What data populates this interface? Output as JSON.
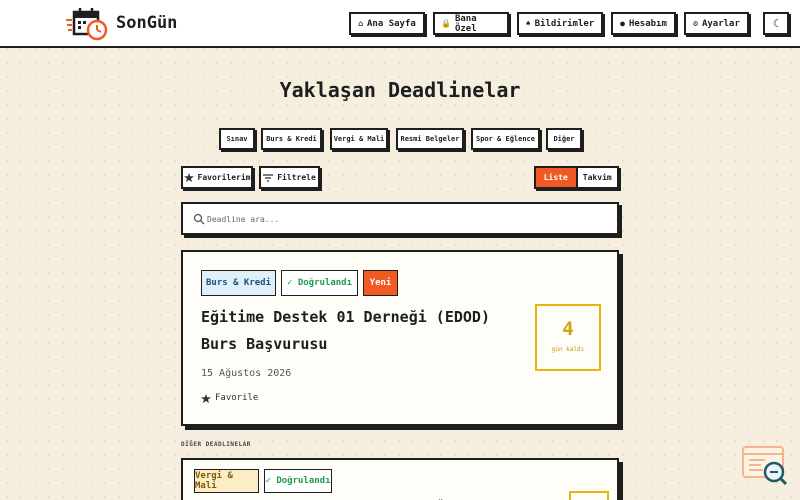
{
  "header": {
    "brand": "SonGün",
    "nav": [
      {
        "label": "Ana Sayfa",
        "icon": "home-icon",
        "glyph": "⌂"
      },
      {
        "label": "Bana Özel",
        "icon": "lock-icon",
        "glyph": "🔒"
      },
      {
        "label": "Bildirimler",
        "icon": "bell-icon",
        "glyph": "♠"
      },
      {
        "label": "Hesabım",
        "icon": "user-icon",
        "glyph": "●"
      },
      {
        "label": "Ayarlar",
        "icon": "gear-icon",
        "glyph": "⚙"
      }
    ],
    "theme_glyph": "☾"
  },
  "page_title": "Yaklaşan Deadlinelar",
  "categories": [
    "Sınav",
    "Burs & Kredi",
    "Vergi & Mali",
    "Resmi Belgeler",
    "Spor & Eğlence",
    "Diğer"
  ],
  "toolbar": {
    "favorites_label": "Favorilerim",
    "filter_label": "Filtrele",
    "view_list": "Liste",
    "view_calendar": "Takvim"
  },
  "search": {
    "placeholder": "Deadline ara..."
  },
  "featured": {
    "tags": [
      "Burs & Kredi",
      "✓ Doğrulandı",
      "Yeni"
    ],
    "title": "Eğitime Destek 01 Derneği (EDOD) Burs Başvurusu",
    "date": "15 Ağustos 2026",
    "favorite_label": "Favorile",
    "days_left": "4",
    "days_unit": "gün kaldı"
  },
  "other_section_label": "DİĞER DEADLINELAR",
  "second": {
    "tags": [
      "Vergi & Mali",
      "✓ Doğrulandı"
    ]
  },
  "colors": {
    "accent": "#f15a22",
    "verified": "#1e9e4a",
    "burs_bg": "#dff0fb",
    "vergi_bg": "#fbeec7",
    "countdown": "#e8b60b"
  }
}
